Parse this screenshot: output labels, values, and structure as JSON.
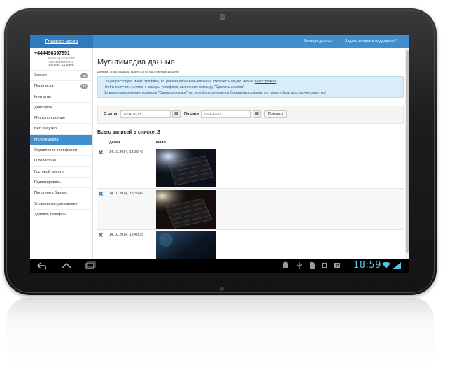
{
  "header": {
    "menu_title": "Главное меню",
    "export_link": "Экспорт данных",
    "support_link": "Задать вопрос в поддержку?"
  },
  "phone": {
    "number": "+444498397651",
    "device": "Samsung GT-A7000",
    "imei": "IDS161093327147",
    "balance": "Баланс: 11 дней"
  },
  "sidebar": {
    "items": [
      {
        "label": "Звонки",
        "badge": "40"
      },
      {
        "label": "Переписка",
        "badge": "12"
      },
      {
        "label": "Контакты"
      },
      {
        "label": "Диктофон"
      },
      {
        "label": "Местоположение"
      },
      {
        "label": "Веб браузер"
      },
      {
        "label": "Мультимедиа",
        "active": true
      },
      {
        "label": "Управление телефоном"
      },
      {
        "label": "О телефоне"
      },
      {
        "label": "Гостевой доступ"
      },
      {
        "label": "Редактировать"
      },
      {
        "label": "Пополнить баланс"
      },
      {
        "label": "Установить приложение"
      },
      {
        "label": "Удалить телефон"
      }
    ]
  },
  "main": {
    "title": "Мультимедиа данные",
    "subtitle": "Данные этого раздела хранятся на протяжении 10 дней",
    "info": {
      "line1_prefix": "Опция расходует много трафика, по умолчанию она выключена. Включить опцию можно",
      "line1_link": "в настройках",
      "line2_prefix": "Чтобы получить снимок с камеры телефона, выполните команду",
      "line2_link": "\"Сделать снимок\"",
      "line3": "Во время выполнения команды \"Сделать снимок\" на телефоне снимается блокировка экрана, это может быть достаточно заметно!"
    },
    "filter": {
      "from_label": "С даты",
      "from_value": "2014-10-13",
      "to_label": "По дату",
      "to_value": "2014-10-15",
      "show_button": "Показать"
    },
    "total": "Всего записей в списке: 3",
    "columns": {
      "date": "Дата ▾",
      "file": "Файл"
    },
    "rows": [
      {
        "date": "14.10.2014, 18:39:40"
      },
      {
        "date": "14.10.2014, 18:39:49"
      },
      {
        "date": "14.10.2014, 18:40:35"
      }
    ]
  },
  "status": {
    "clock": "18:59"
  },
  "colors": {
    "accent": "#3f8ed0",
    "info_bg": "#d8edf8",
    "delete": "#2f7bbd",
    "clock": "#5bbde4"
  }
}
